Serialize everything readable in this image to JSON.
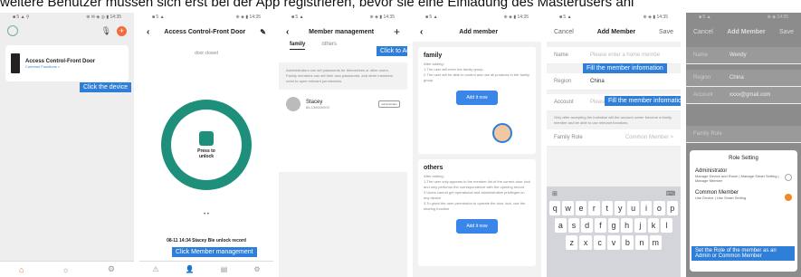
{
  "caption": "weitere Benutzer müssen sich erst bei der App registrieren, bevor sie eine Einladung des Masterusers anl",
  "screen1": {
    "device_name": "Access Control-Front Door",
    "device_sub": "Common Functions >",
    "callout": "Click the device",
    "status_left": "■ 5 ▲ ⚲",
    "status_right": "⊕ ✉ ◈ ◎ ▮ 14:35"
  },
  "screen2": {
    "title": "Access Control-Front Door",
    "door_status": "door closed",
    "unlock_label_1": "Press to",
    "unlock_label_2": "unlock",
    "record": "08-11 14:34 Stacey Ble unlock record",
    "callout": "Click Member management",
    "tab_labels": [
      "Alarm records",
      "Member Management",
      "Temporary password",
      "Settings"
    ]
  },
  "screen3": {
    "title": "Member management",
    "tab_family": "family",
    "tab_others": "others",
    "callout": "Click to Ad",
    "description": "Administrators can set passwords for themselves or other users. Family members can set their own passwords, and other members need to open relevant permissions.",
    "member_name": "Stacey",
    "member_phone": "86-136000000",
    "member_badge": "Administrator"
  },
  "screen4": {
    "title": "Add member",
    "family_title": "family",
    "family_desc": "After adding:\n1.The user will enter the family group\n2.The user will be able to control and use all products in the family group",
    "add_btn": "Add it now",
    "others_title": "others",
    "others_desc": "After adding:\n1.The user only appears in the member list of the current door lock and only performs the correspondence with the opening record\n2.Users cannot get operational and administrative privileges on any device\n3.To grant the user permission to operate the door lock, use the sharing function",
    "add_btn2": "Add it now"
  },
  "screen5": {
    "cancel": "Cancel",
    "title": "Add Member",
    "save": "Save",
    "name_label": "Name",
    "name_placeholder": "Please enter a home membe",
    "callout_1": "Fill the member information",
    "region_label": "Region",
    "region_value": "China",
    "callout_2": "Fill the member information",
    "account_label": "Account",
    "account_placeholder": "Please enter your account",
    "notice": "Only after accepting the invitation will the account owner become a family member and be able to use relevant functions.",
    "role_label": "Family Role",
    "role_value": "Common Member >",
    "kb_row1": [
      "q",
      "w",
      "e",
      "r",
      "t",
      "y",
      "u",
      "i",
      "o",
      "p"
    ],
    "kb_row2": [
      "a",
      "s",
      "d",
      "f",
      "g",
      "h",
      "j",
      "k",
      "l"
    ],
    "kb_row3": [
      "z",
      "x",
      "c",
      "v",
      "b",
      "n",
      "m"
    ]
  },
  "screen6": {
    "cancel": "Cancel",
    "title": "Add Member",
    "save": "Save",
    "name_label": "Name",
    "name_value": "Wendy",
    "region_label": "Region",
    "region_value": "China",
    "account_label": "Account",
    "account_value": "xxxx@gmail.com",
    "role_label": "Family Role",
    "sheet_title": "Role Setting",
    "opt1_title": "Administrator",
    "opt1_desc": "Manage Device and Room | Manage Smart Setting | Manage Member",
    "opt2_title": "Common Member",
    "opt2_desc": "Use Device | Use Smart Setting",
    "callout": "Set the Role of the member as an Admin or Common Member"
  },
  "colors": {
    "accent": "#2f7fd8",
    "green": "#1e8f7a",
    "orange": "#f08a24"
  }
}
